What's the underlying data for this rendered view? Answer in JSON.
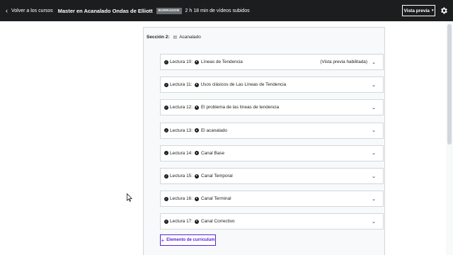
{
  "header": {
    "back_label": "Volver a los cursos",
    "course_title": "Master en Acanalado Ondas de Elliott",
    "status_badge": "BORRADOR",
    "uploaded_text": "2 h 18 min de vídeos subidos",
    "preview_button": "Vista previa"
  },
  "section": {
    "label": "Sección 2:",
    "title": "Acanalado"
  },
  "lectures": [
    {
      "label": "Lectura 10:",
      "title": "Líneas de Tendencia",
      "note": "(Vista previa habilitada)"
    },
    {
      "label": "Lectura 11:",
      "title": "Usos clásicos de Las Líneas de Tendencia",
      "note": ""
    },
    {
      "label": "Lectura 12:",
      "title": "El problema de las líneas de tendencia",
      "note": ""
    },
    {
      "label": "Lectura 13:",
      "title": "El acanalado",
      "note": ""
    },
    {
      "label": "Lectura 14:",
      "title": "Canal Base",
      "note": ""
    },
    {
      "label": "Lectura 15:",
      "title": "Canal Temporal",
      "note": ""
    },
    {
      "label": "Lectura 16:",
      "title": "Canal Terminal",
      "note": ""
    },
    {
      "label": "Lectura 17:",
      "title": "Canal Correctivo",
      "note": ""
    }
  ],
  "add_button": "Elemento de currículum",
  "colors": {
    "topbar": "#1c1d1f",
    "accent": "#5624d0",
    "section_bg": "#f7f9fa",
    "border": "#d1d7dc"
  }
}
